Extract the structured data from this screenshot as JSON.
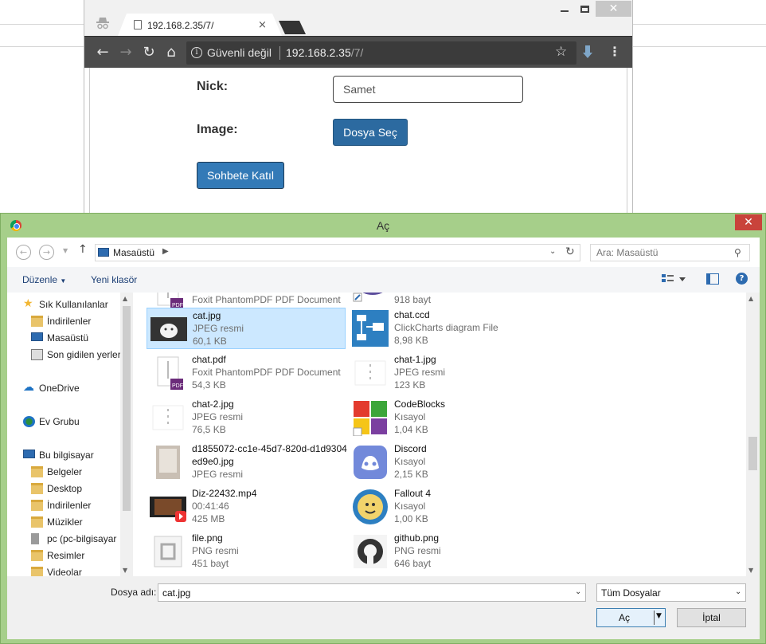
{
  "browser": {
    "tab_title": "192.168.2.35/7/",
    "tab_close": "×",
    "secure_label": "Güvenli değil",
    "url_host": "192.168.2.35",
    "url_path": "/7/",
    "win_close": "✕"
  },
  "form": {
    "nick_label": "Nick:",
    "nick_value": "Samet",
    "image_label": "Image:",
    "file_button": "Dosya Seç",
    "join_button": "Sohbete Katıl"
  },
  "dialog": {
    "title": "Aç",
    "close": "✕",
    "location": "Masaüstü",
    "search_placeholder": "Ara: Masaüstü",
    "organize": "Düzenle",
    "new_folder": "Yeni klasör",
    "nav_items": [
      {
        "label": "Sık Kullanılanlar",
        "icon": "star-icon"
      },
      {
        "label": "İndirilenler",
        "icon": "downloads-folder-icon"
      },
      {
        "label": "Masaüstü",
        "icon": "desktop-icon"
      },
      {
        "label": "Son gidilen yerler",
        "icon": "recent-places-icon"
      },
      {
        "label": "OneDrive",
        "icon": "onedrive-icon"
      },
      {
        "label": "Ev Grubu",
        "icon": "homegroup-icon"
      },
      {
        "label": "Bu bilgisayar",
        "icon": "computer-icon"
      },
      {
        "label": "Belgeler",
        "icon": "documents-folder-icon"
      },
      {
        "label": "Desktop",
        "icon": "desktop-folder-icon"
      },
      {
        "label": "İndirilenler",
        "icon": "downloads-folder-icon"
      },
      {
        "label": "Müzikler",
        "icon": "music-folder-icon"
      },
      {
        "label": "pc (pc-bilgisayar",
        "icon": "network-drive-icon"
      },
      {
        "label": "Resimler",
        "icon": "pictures-folder-icon"
      },
      {
        "label": "Videolar",
        "icon": "videos-folder-icon"
      }
    ],
    "files_left": [
      {
        "name": "",
        "line1": "Foxit PhantomPDF PDF Document",
        "line2": "",
        "icon": "pdf-icon"
      },
      {
        "name": "cat.jpg",
        "line1": "JPEG resmi",
        "line2": "60,1 KB",
        "icon": "cat-thumbnail-icon",
        "selected": true
      },
      {
        "name": "chat.pdf",
        "line1": "Foxit PhantomPDF PDF Document",
        "line2": "54,3 KB",
        "icon": "pdf-icon"
      },
      {
        "name": "chat-2.jpg",
        "line1": "JPEG resmi",
        "line2": "76,5 KB",
        "icon": "image-thumbnail-icon"
      },
      {
        "name": "d1855072-cc1e-45d7-820d-d1d9304",
        "name2": "ed9e0.jpg",
        "line1": "JPEG resmi",
        "line2": "",
        "icon": "photo-thumbnail-icon"
      },
      {
        "name": "Diz-22432.mp4",
        "line1": "00:41:46",
        "line2": "425 MB",
        "icon": "video-thumbnail-icon"
      },
      {
        "name": "file.png",
        "line1": "PNG resmi",
        "line2": "451 bayt",
        "icon": "png-thumbnail-icon"
      }
    ],
    "files_right": [
      {
        "name": "",
        "line1": "918 bayt",
        "line2": "",
        "icon": "shortcut-icon"
      },
      {
        "name": "chat.ccd",
        "line1": "ClickCharts diagram File",
        "line2": "8,98 KB",
        "icon": "clickcharts-icon"
      },
      {
        "name": "chat-1.jpg",
        "line1": "JPEG resmi",
        "line2": "123 KB",
        "icon": "image-thumbnail-icon"
      },
      {
        "name": "CodeBlocks",
        "line1": "Kısayol",
        "line2": "1,04 KB",
        "icon": "codeblocks-icon"
      },
      {
        "name": "Discord",
        "line1": "Kısayol",
        "line2": "2,15 KB",
        "icon": "discord-icon"
      },
      {
        "name": "Fallout 4",
        "line1": "Kısayol",
        "line2": "1,00 KB",
        "icon": "fallout-icon"
      },
      {
        "name": "github.png",
        "line1": "PNG resmi",
        "line2": "646 bayt",
        "icon": "github-icon"
      }
    ],
    "filename_label": "Dosya adı:",
    "filename_value": "cat.jpg",
    "filetype": "Tüm Dosyalar",
    "open_button": "Aç",
    "cancel_button": "İptal"
  }
}
